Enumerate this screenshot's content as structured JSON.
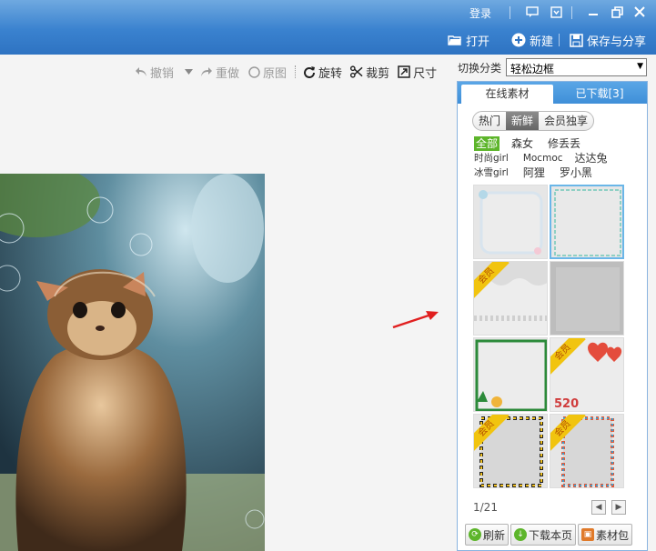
{
  "titlebar": {
    "login": "登录",
    "open_label": "打开",
    "new_label": "新建",
    "save_share_label": "保存与分享"
  },
  "edit_toolbar": {
    "undo": "撤销",
    "redo": "重做",
    "original": "原图",
    "rotate": "旋转",
    "crop": "裁剪",
    "size": "尺寸"
  },
  "category": {
    "label": "切换分类",
    "selected": "轻松边框"
  },
  "panel": {
    "tabs": [
      "在线素材",
      "已下载[3]"
    ],
    "pills": [
      "热门",
      "新鲜",
      "会员独享"
    ],
    "filters": [
      [
        "全部",
        "森女",
        "修丢丢"
      ],
      [
        "时尚girl",
        "Mocmoc",
        "达达兔"
      ],
      [
        "冰雪girl",
        "阿狸",
        "罗小黑"
      ]
    ],
    "thumbs": [
      {
        "vip": false,
        "selected": false
      },
      {
        "vip": false,
        "selected": true
      },
      {
        "vip": true,
        "selected": false
      },
      {
        "vip": false,
        "selected": false
      },
      {
        "vip": false,
        "selected": false
      },
      {
        "vip": true,
        "selected": false
      },
      {
        "vip": true,
        "selected": false
      },
      {
        "vip": true,
        "selected": false
      }
    ],
    "vip_badge": "会员",
    "pager": "1/21",
    "footer": {
      "refresh": "刷新",
      "download_page": "下载本页",
      "material_pack": "素材包"
    }
  },
  "colors": {
    "titlebar": "#3a82cf",
    "accent_green": "#5db52b",
    "arrow": "#e02020"
  }
}
